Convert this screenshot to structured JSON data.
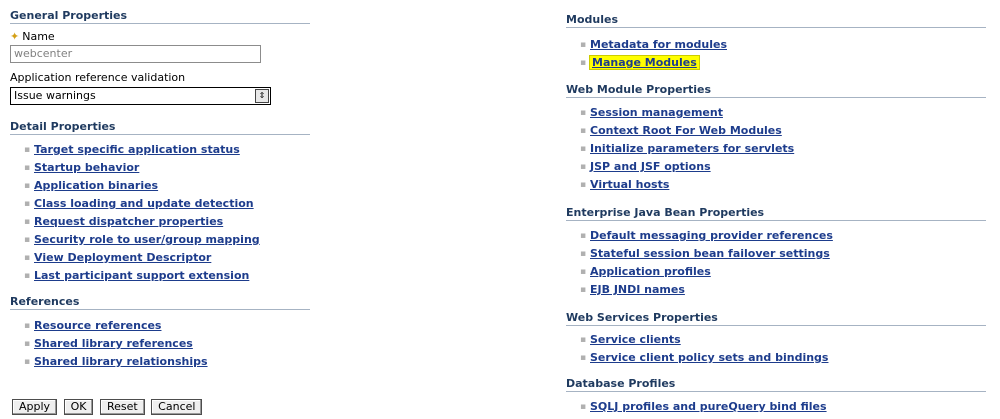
{
  "general": {
    "heading": "General Properties",
    "name_label": "Name",
    "name_value": "webcenter",
    "validation_label": "Application reference validation",
    "validation_value": "Issue warnings"
  },
  "detail": {
    "heading": "Detail Properties",
    "items": [
      "Target specific application status",
      "Startup behavior",
      "Application binaries",
      "Class loading and update detection",
      "Request dispatcher properties",
      "Security role to user/group mapping",
      "View Deployment Descriptor",
      "Last participant support extension"
    ]
  },
  "references": {
    "heading": "References",
    "items": [
      "Resource references",
      "Shared library references",
      "Shared library relationships"
    ]
  },
  "buttons": {
    "apply": "Apply",
    "ok": "OK",
    "reset": "Reset",
    "cancel": "Cancel"
  },
  "modules": {
    "heading": "Modules",
    "items": [
      "Metadata for modules",
      "Manage Modules"
    ]
  },
  "web_module": {
    "heading": "Web Module Properties",
    "items": [
      "Session management",
      "Context Root For Web Modules",
      "Initialize parameters for servlets",
      "JSP and JSF options",
      "Virtual hosts"
    ]
  },
  "ejb": {
    "heading": "Enterprise Java Bean Properties",
    "items": [
      "Default messaging provider references",
      "Stateful session bean failover settings",
      "Application profiles",
      "EJB JNDI names"
    ]
  },
  "web_services": {
    "heading": "Web Services Properties",
    "items": [
      "Service clients",
      "Service client policy sets and bindings"
    ]
  },
  "database": {
    "heading": "Database Profiles",
    "items": [
      "SQLJ profiles and pureQuery bind files"
    ]
  },
  "colors": {
    "link": "#1d3c8c",
    "heading": "#1f3a5f",
    "highlight": "#ffff00"
  }
}
